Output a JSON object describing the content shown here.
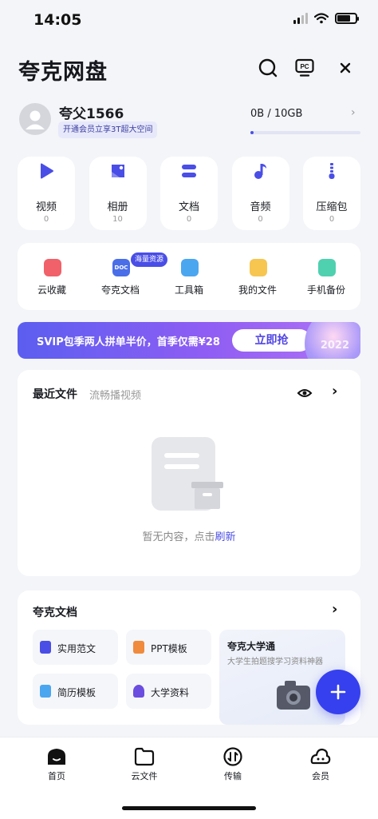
{
  "status": {
    "time": "14:05"
  },
  "header": {
    "title": "夸克网盘",
    "pc_label": "PC"
  },
  "profile": {
    "name": "夸父1566",
    "vip_promo": "开通会员立享3T超大空间",
    "storage_text": "0B  /  10GB",
    "storage_fraction": 0.02
  },
  "quick": [
    {
      "label": "视频",
      "count": "0",
      "icon": "play-icon",
      "color": "#4a4ee6"
    },
    {
      "label": "相册",
      "count": "10",
      "icon": "photo-icon",
      "color": "#4a4ee6"
    },
    {
      "label": "文档",
      "count": "0",
      "icon": "document-icon",
      "color": "#4a4ee6"
    },
    {
      "label": "音频",
      "count": "0",
      "icon": "music-icon",
      "color": "#4a4ee6"
    },
    {
      "label": "压缩包",
      "count": "0",
      "icon": "zip-icon",
      "color": "#4a4ee6"
    }
  ],
  "tools": {
    "badge": "海量资源",
    "items": [
      {
        "label": "云收藏",
        "color": "#f0616a"
      },
      {
        "label": "夸克文档",
        "color": "#4a6ee8"
      },
      {
        "label": "工具箱",
        "color": "#4ba6f0"
      },
      {
        "label": "我的文件",
        "color": "#f6c651"
      },
      {
        "label": "手机备份",
        "color": "#4fd1b0"
      }
    ],
    "doc_icon_text": "DOC"
  },
  "banner": {
    "text": "SVIP包季两人拼单半价，首季仅需¥28",
    "button": "立即抢",
    "year": "2022"
  },
  "recent": {
    "title": "最近文件",
    "subtitle": "流畅播视频",
    "empty_text": "暂无内容，点击",
    "empty_link": "刷新"
  },
  "docs": {
    "title": "夸克文档",
    "chips": [
      {
        "label": "实用范文",
        "color": "#4a4ee6"
      },
      {
        "label": "PPT模板",
        "color": "#f08a3d"
      },
      {
        "label": "简历模板",
        "color": "#4ba6f0"
      },
      {
        "label": "大学资料",
        "color": "#6b4de0"
      }
    ],
    "university": {
      "title": "夸克大学通",
      "subtitle": "大学生拍题搜学习资料神器"
    }
  },
  "tabbar": [
    {
      "label": "首页",
      "icon": "home-icon"
    },
    {
      "label": "云文件",
      "icon": "folder-icon"
    },
    {
      "label": "传输",
      "icon": "transfer-icon"
    },
    {
      "label": "会员",
      "icon": "member-icon"
    }
  ]
}
